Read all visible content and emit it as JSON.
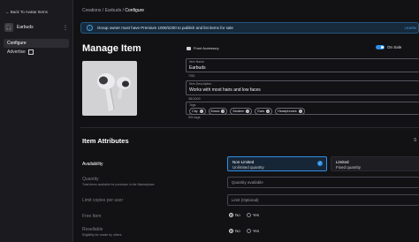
{
  "sidebar": {
    "back_label": "Back To Avatar Items",
    "item_name": "Earbuds",
    "menu_icon": "more-vertical-icon",
    "links": [
      {
        "label": "Configure",
        "active": true
      },
      {
        "label": "Advertise",
        "active": false
      }
    ]
  },
  "breadcrumb": {
    "items": [
      "Creations",
      "Earbuds",
      "Configure"
    ],
    "separator": "/"
  },
  "banner": {
    "text": "Group owner must have Premium 1000/2200 to publish and list items for sale",
    "link": "LEARN"
  },
  "page_title": "Manage Item",
  "asset_type": "Front Accessory",
  "on_sale_label": "On Sale",
  "form": {
    "name_label": "Item Name",
    "name_value": "Earbuds",
    "name_counter": "7/50",
    "description_label": "Item Description",
    "description_value": "Works with most hairs and low faces",
    "description_counter": "35/1000",
    "tags_label": "Tags",
    "tags": [
      "City",
      "Music",
      "Modern",
      "Ears",
      "Headphones"
    ],
    "tags_counter": "5/5 tags"
  },
  "attributes": {
    "section_title": "Item Attributes",
    "right_cut": "S",
    "availability_label": "Availability",
    "options": [
      {
        "title": "Non-Limited",
        "subtitle": "Unlimited quantity",
        "selected": true
      },
      {
        "title": "Limited",
        "subtitle": "Fixed quantity",
        "selected": false
      }
    ],
    "quantity_label": "Quantity",
    "quantity_sub": "Total items available for purchase in the Marketplace",
    "quantity_placeholder": "Quantity available",
    "limit_label": "Limit copies per user",
    "limit_placeholder": "Limit (Optional)",
    "free_label": "Free Item",
    "free_options": [
      "No",
      "Yes"
    ],
    "resellable_label": "Resellable",
    "resellable_sub": "Eligibility for resale by others",
    "resellable_options": [
      "No",
      "Yes"
    ]
  },
  "colors": {
    "accent": "#2f8fe6",
    "background": "#121215",
    "sidebar": "#1b1b1f"
  }
}
